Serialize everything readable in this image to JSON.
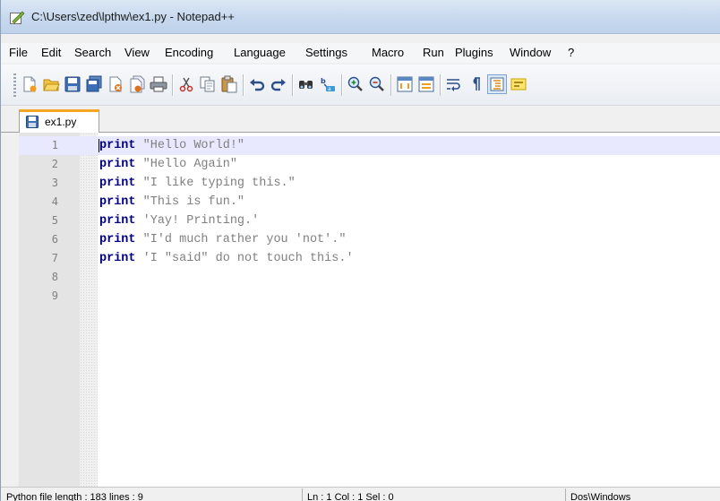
{
  "window": {
    "title": "C:\\Users\\zed\\lpthw\\ex1.py - Notepad++"
  },
  "menu": [
    "File",
    "Edit",
    "Search",
    "View",
    "Encoding",
    "Language",
    "Settings",
    "Macro",
    "Run",
    "Plugins",
    "Window",
    "?"
  ],
  "toolbar": {
    "icons": [
      "new-file-icon",
      "open-file-icon",
      "save-icon",
      "save-all-icon",
      "close-icon",
      "close-all-icon",
      "print-icon",
      "cut-icon",
      "copy-icon",
      "paste-icon",
      "undo-icon",
      "redo-icon",
      "find-icon",
      "replace-icon",
      "zoom-in-icon",
      "zoom-out-icon",
      "sync-vertical-icon",
      "sync-horizontal-icon",
      "word-wrap-icon",
      "show-all-chars-icon",
      "indent-guide-icon",
      "highlight-icon"
    ]
  },
  "tabs": [
    {
      "label": "ex1.py",
      "active": true
    }
  ],
  "editor": {
    "current_line": 1,
    "lines": [
      {
        "num": "1",
        "keyword": "print",
        "text": " \"Hello World!\""
      },
      {
        "num": "2",
        "keyword": "print",
        "text": " \"Hello Again\""
      },
      {
        "num": "3",
        "keyword": "print",
        "text": " \"I like typing this.\""
      },
      {
        "num": "4",
        "keyword": "print",
        "text": " \"This is fun.\""
      },
      {
        "num": "5",
        "keyword": "print",
        "text": " 'Yay! Printing.'"
      },
      {
        "num": "6",
        "keyword": "print",
        "text": " \"I'd much rather you 'not'.\""
      },
      {
        "num": "7",
        "keyword": "print",
        "text": " 'I \"said\" do not touch this.'"
      },
      {
        "num": "8",
        "keyword": "",
        "text": ""
      },
      {
        "num": "9",
        "keyword": "",
        "text": ""
      }
    ]
  },
  "status": {
    "length": "Python file    length : 183    lines : 9",
    "position": "Ln : 1    Col : 1    Sel : 0",
    "eol": "Dos\\Windows"
  },
  "colors": {
    "keyword": "#000080",
    "string": "#808080",
    "current_line": "#e8e8ff",
    "tab_accent": "#f5a623"
  }
}
